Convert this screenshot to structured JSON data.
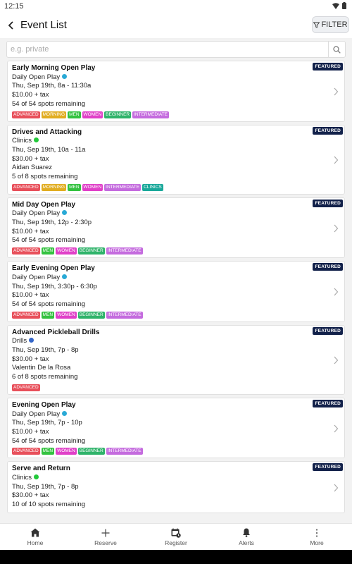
{
  "status_bar": {
    "time": "12:15"
  },
  "header": {
    "title": "Event List",
    "filter_label": "FILTER"
  },
  "search": {
    "placeholder": "e.g. private",
    "value": ""
  },
  "colors": {
    "ADVANCED": "#e8505b",
    "MORNING": "#e1ad21",
    "MEN": "#34c240",
    "WOMEN": "#e040c8",
    "BEGINNER": "#2fb36a",
    "INTERMEDIATE": "#c46bde",
    "CLINICS": "#1aa89a",
    "featured": "#12214a",
    "dot_open_play": "#2aaad6",
    "dot_clinics": "#22c93a",
    "dot_drills": "#3466c9"
  },
  "events": [
    {
      "featured": "FEATURED",
      "name": "Early Morning Open Play",
      "category": "Daily Open Play",
      "dot": "dot_open_play",
      "datetime": "Thu, Sep 19th, 8a - 11:30a",
      "price": "$10.00 + tax",
      "instructor": "",
      "spots": "54 of 54 spots remaining",
      "tags": [
        "ADVANCED",
        "MORNING",
        "MEN",
        "WOMEN",
        "BEGINNER",
        "INTERMEDIATE"
      ]
    },
    {
      "featured": "FEATURED",
      "name": "Drives and Attacking",
      "category": "Clinics",
      "dot": "dot_clinics",
      "datetime": "Thu, Sep 19th, 10a - 11a",
      "price": "$30.00 + tax",
      "instructor": "Aidan Suarez",
      "spots": "5 of 8 spots remaining",
      "tags": [
        "ADVANCED",
        "MORNING",
        "MEN",
        "WOMEN",
        "INTERMEDIATE",
        "CLINICS"
      ]
    },
    {
      "featured": "FEATURED",
      "name": "Mid Day Open Play",
      "category": "Daily Open Play",
      "dot": "dot_open_play",
      "datetime": "Thu, Sep 19th, 12p - 2:30p",
      "price": "$10.00 + tax",
      "instructor": "",
      "spots": "54 of 54 spots remaining",
      "tags": [
        "ADVANCED",
        "MEN",
        "WOMEN",
        "BEGINNER",
        "INTERMEDIATE"
      ]
    },
    {
      "featured": "FEATURED",
      "name": "Early Evening Open Play",
      "category": "Daily Open Play",
      "dot": "dot_open_play",
      "datetime": "Thu, Sep 19th, 3:30p - 6:30p",
      "price": "$10.00 + tax",
      "instructor": "",
      "spots": "54 of 54 spots remaining",
      "tags": [
        "ADVANCED",
        "MEN",
        "WOMEN",
        "BEGINNER",
        "INTERMEDIATE"
      ]
    },
    {
      "featured": "FEATURED",
      "name": "Advanced Pickleball Drills",
      "category": "Drills",
      "dot": "dot_drills",
      "datetime": "Thu, Sep 19th, 7p - 8p",
      "price": "$30.00 + tax",
      "instructor": "Valentin De la Rosa",
      "spots": "6 of 8 spots remaining",
      "tags": [
        "ADVANCED"
      ]
    },
    {
      "featured": "FEATURED",
      "name": "Evening Open Play",
      "category": "Daily Open Play",
      "dot": "dot_open_play",
      "datetime": "Thu, Sep 19th, 7p - 10p",
      "price": "$10.00 + tax",
      "instructor": "",
      "spots": "54 of 54 spots remaining",
      "tags": [
        "ADVANCED",
        "MEN",
        "WOMEN",
        "BEGINNER",
        "INTERMEDIATE"
      ]
    },
    {
      "featured": "FEATURED",
      "name": "Serve and Return",
      "category": "Clinics",
      "dot": "dot_clinics",
      "datetime": "Thu, Sep 19th, 7p - 8p",
      "price": "$30.00 + tax",
      "instructor": "",
      "spots": "10 of 10 spots remaining",
      "tags": []
    }
  ],
  "bottom_nav": [
    {
      "label": "Home",
      "icon": "home-icon"
    },
    {
      "label": "Reserve",
      "icon": "plus-icon"
    },
    {
      "label": "Register",
      "icon": "calendar-clock-icon"
    },
    {
      "label": "Alerts",
      "icon": "bell-icon"
    },
    {
      "label": "More",
      "icon": "more-vertical-icon"
    }
  ]
}
